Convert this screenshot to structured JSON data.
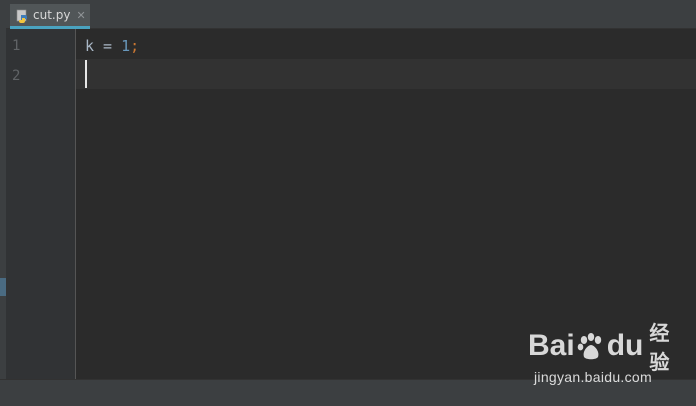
{
  "tab": {
    "label": "cut.py",
    "close_glyph": "✕",
    "icon": "python-file-icon"
  },
  "editor": {
    "lines": [
      {
        "number": "1",
        "tokens": [
          {
            "text": "k",
            "kind": "ident"
          },
          {
            "text": " = ",
            "kind": "op"
          },
          {
            "text": "1",
            "kind": "num"
          },
          {
            "text": ";",
            "kind": "punc"
          }
        ]
      },
      {
        "number": "2",
        "tokens": []
      }
    ],
    "caret_line": 2
  },
  "colors": {
    "background": "#2b2b2b",
    "gutter": "#313335",
    "tab_underline": "#4aa3c0",
    "identifier": "#a9b7c6",
    "number": "#6897bb",
    "punctuation": "#cc7832",
    "line_number": "#606366"
  },
  "watermark": {
    "brand_left": "Bai",
    "brand_right": "du",
    "brand_suffix": "经验",
    "url": "jingyan.baidu.com"
  }
}
